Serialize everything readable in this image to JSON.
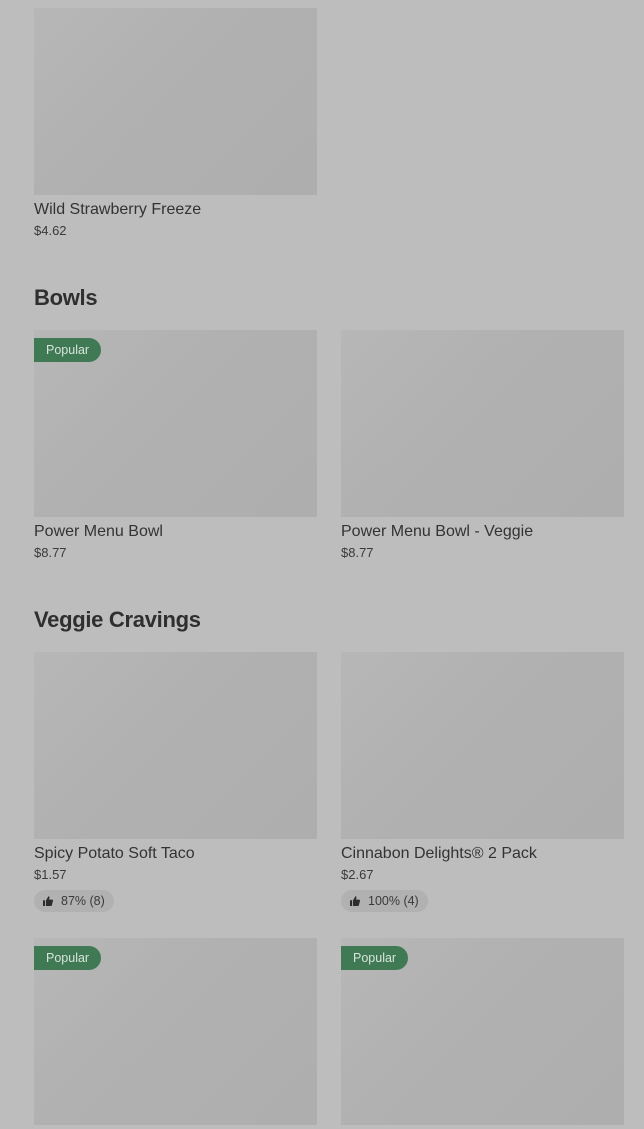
{
  "sections": {
    "bowls": {
      "title": "Bowls"
    },
    "veggie": {
      "title": "Veggie Cravings"
    }
  },
  "items": {
    "wild_strawberry": {
      "name": "Wild Strawberry Freeze",
      "price": "$4.62"
    },
    "power_bowl": {
      "name": "Power Menu Bowl",
      "price": "$8.77",
      "badge": "Popular"
    },
    "power_bowl_veggie": {
      "name": "Power Menu Bowl - Veggie",
      "price": "$8.77"
    },
    "spicy_potato": {
      "name": "Spicy Potato Soft Taco",
      "price": "$1.57",
      "rating": "87% (8)"
    },
    "cinnabon": {
      "name": "Cinnabon Delights® 2 Pack",
      "price": "$2.67",
      "rating": "100% (4)"
    },
    "veggie_item_3": {
      "badge": "Popular"
    },
    "veggie_item_4": {
      "badge": "Popular"
    }
  },
  "colors": {
    "background": "#bdbdbd",
    "badge": "#3f7a55",
    "image_placeholder": "#b3b3b3"
  }
}
